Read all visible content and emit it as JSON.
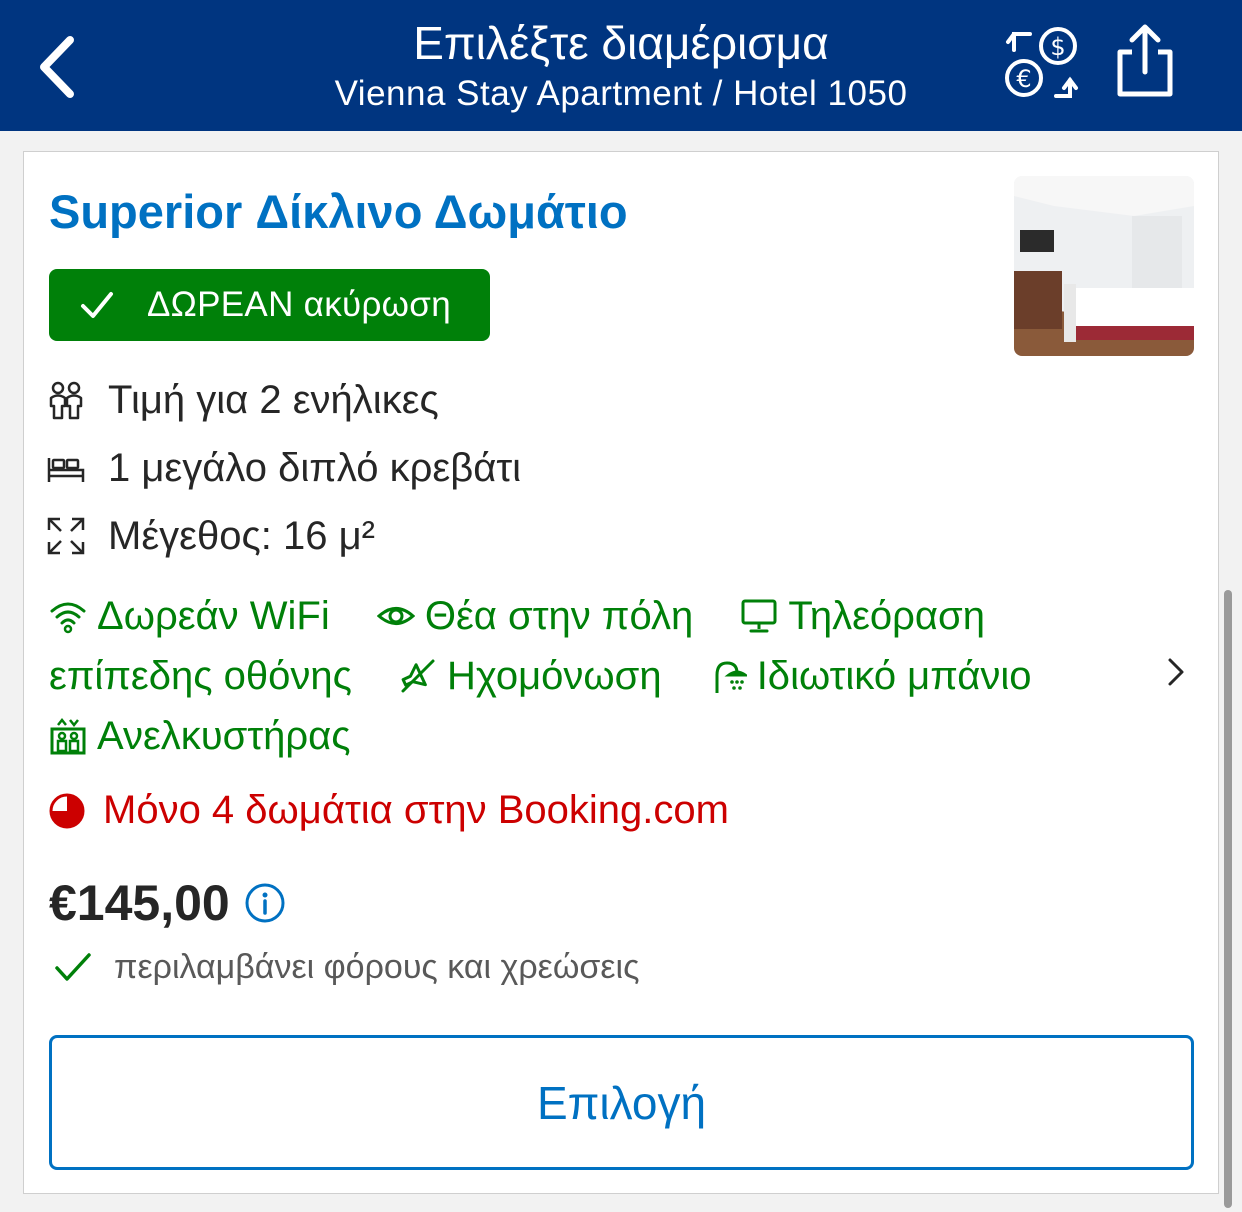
{
  "header": {
    "title": "Επιλέξτε διαμέρισμα",
    "subtitle": "Vienna Stay Apartment / Hotel 1050",
    "back_icon": "chevron-left-icon",
    "currency_icon": "currency-exchange-icon",
    "share_icon": "share-icon"
  },
  "room": {
    "title": "Superior Δίκλινο Δωμάτιο",
    "photo": "room-photo",
    "badge": "ΔΩΡΕΑΝ ακύρωση",
    "facts": [
      {
        "icon": "adults-icon",
        "text": "Τιμή για 2 ενήλικες"
      },
      {
        "icon": "bed-icon",
        "text": "1 μεγάλο διπλό κρεβάτι"
      },
      {
        "icon": "size-icon",
        "text": "Μέγεθος: 16 μ²"
      }
    ],
    "amenities": [
      {
        "icon": "wifi-icon",
        "text": "Δωρεάν WiFi"
      },
      {
        "icon": "eye-icon",
        "text": "Θέα στην πόλη"
      },
      {
        "icon": "tv-icon",
        "text_a": "Τηλεόραση",
        "text_b": "επίπεδης οθόνης"
      },
      {
        "icon": "soundproof-icon",
        "text": "Ηχομόνωση"
      },
      {
        "icon": "shower-icon",
        "text": "Ιδιωτικό μπάνιο"
      },
      {
        "icon": "elevator-icon",
        "text": "Ανελκυστήρας"
      }
    ],
    "scarcity": "Μόνο 4 δωμάτια στην Booking.com",
    "price": "€145,00",
    "tax_note": "περιλαμβάνει φόρους και χρεώσεις",
    "select_label": "Επιλογή"
  },
  "colors": {
    "header_bg": "#003580",
    "link_blue": "#0071c2",
    "green": "#008009",
    "red": "#cc0000"
  }
}
